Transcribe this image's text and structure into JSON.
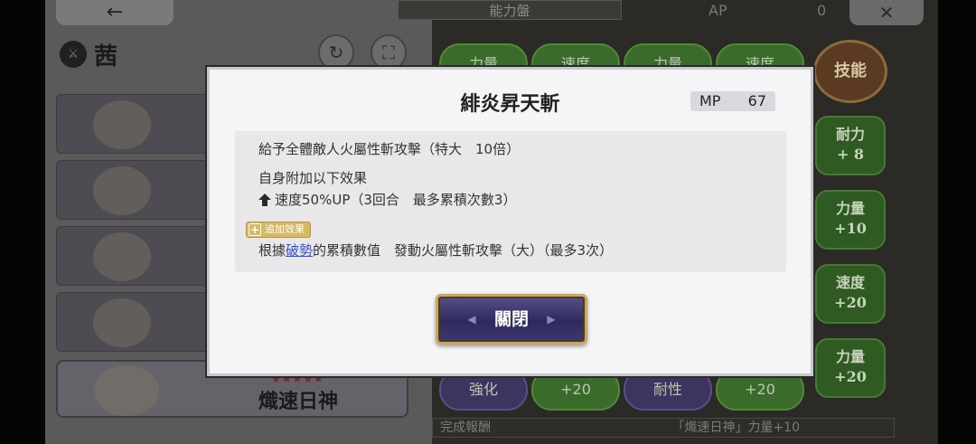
{
  "left_panel": {
    "back_arrow": "←",
    "character_name": "茜",
    "selected_card": {
      "stars": "★★★★★",
      "name": "熾速日神"
    }
  },
  "header": {
    "tab_title": "能力盤",
    "ap_label": "AP",
    "ap_value": "0",
    "close_symbol": "✕"
  },
  "board": {
    "top_nodes": [
      "力量",
      "速度",
      "力量",
      "速度"
    ],
    "skill_medal": "技能",
    "side_stats": [
      {
        "name": "耐力",
        "value": "+ 8"
      },
      {
        "name": "力量",
        "value": "+10"
      },
      {
        "name": "速度",
        "value": "+20"
      },
      {
        "name": "力量",
        "value": "+20"
      }
    ],
    "bottom_nodes": [
      "強化",
      "+20",
      "耐性",
      "+20"
    ]
  },
  "reward": {
    "label": "完成報酬",
    "value": "「熾速日神」力量+10"
  },
  "modal": {
    "title": "緋炎昇天斬",
    "mp_label": "MP",
    "mp_value": "67",
    "desc_line1": "給予全體敵人火屬性斬攻擊（特大　10倍）",
    "desc_line2": "自身附加以下效果",
    "desc_line3": "速度50%UP（3回合　最多累積次數3）",
    "extra_badge": "追加效果",
    "extra_prefix": "根據",
    "extra_link": "破勢",
    "extra_suffix": "的累積數值　發動火屬性斬攻擊（大）（最多3次）",
    "close_button": "關閉"
  },
  "colors": {
    "modal_bg": "#f5f4f6",
    "link": "#3a52c8",
    "button_gold": "#c6a85e",
    "button_purple": "#2f2a5c"
  }
}
